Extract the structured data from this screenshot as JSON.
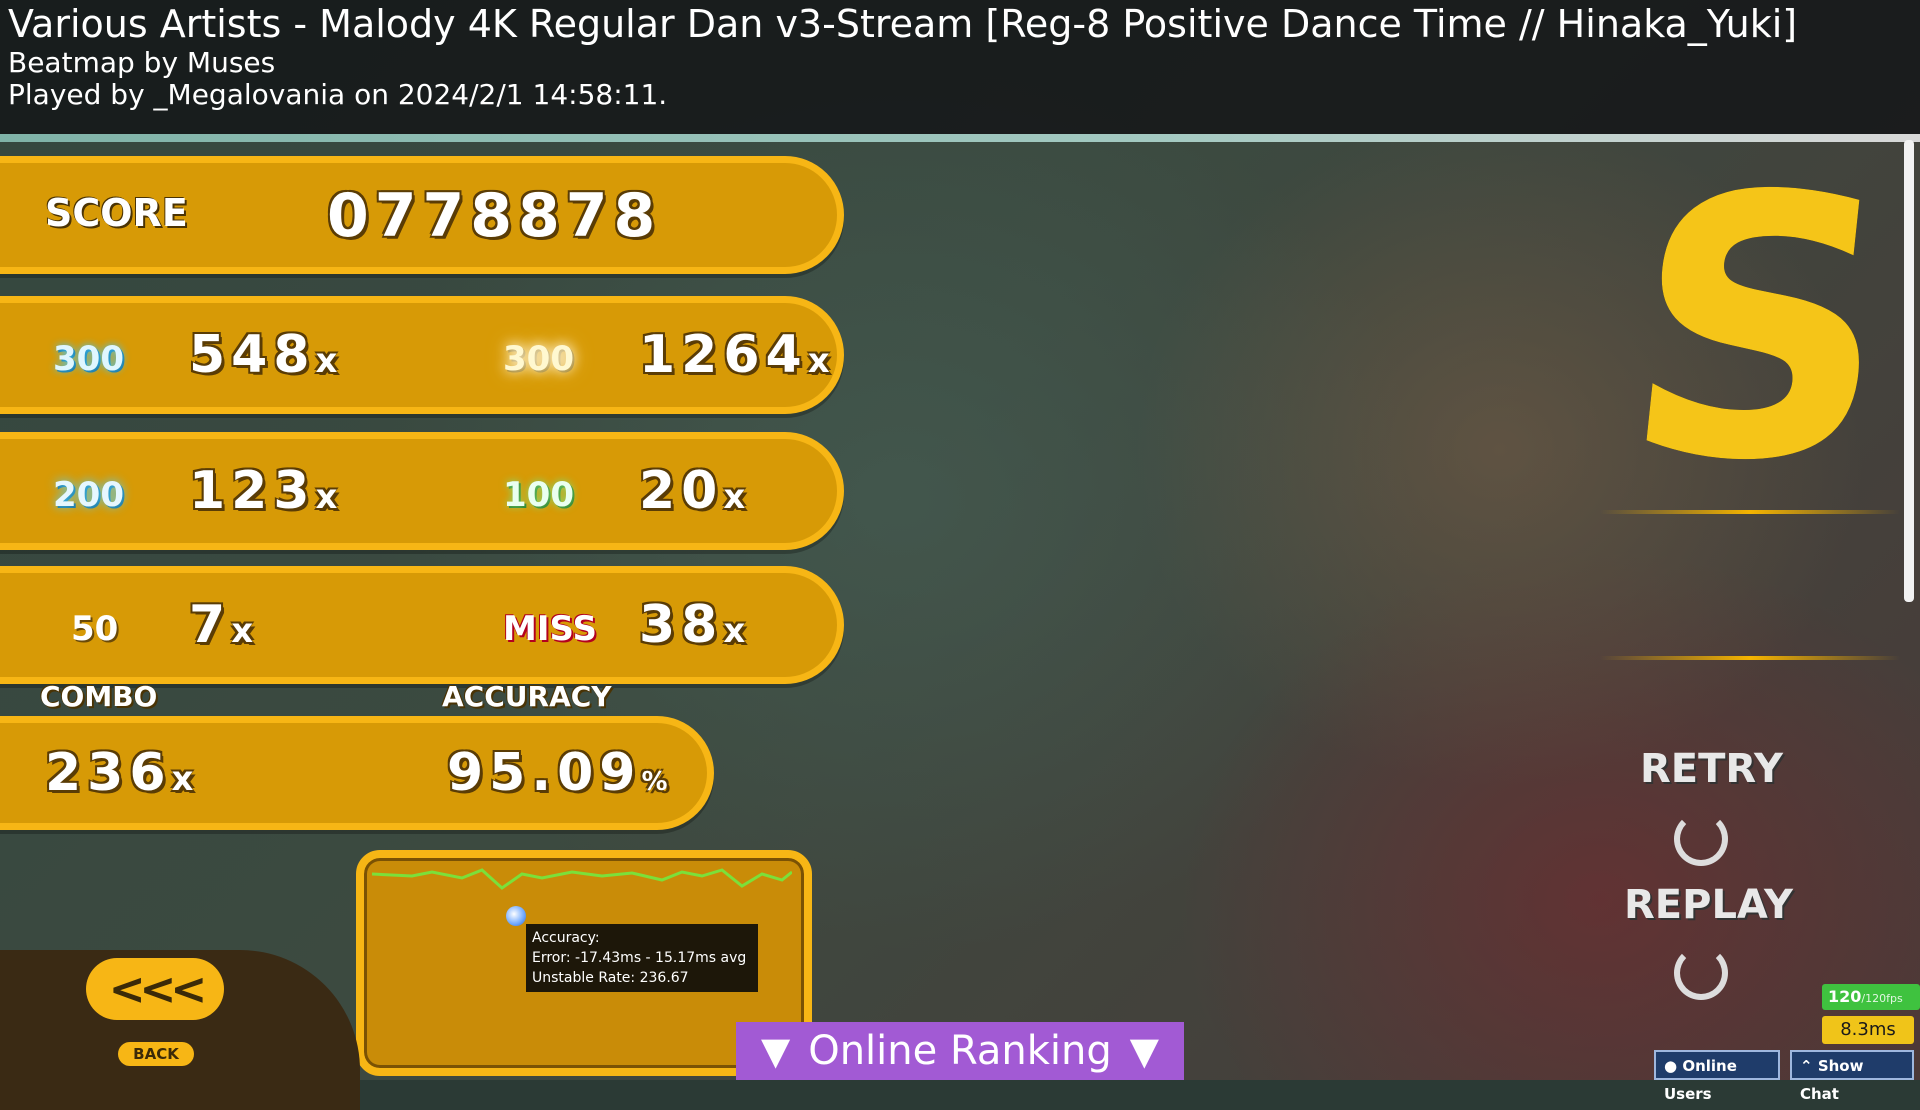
{
  "header": {
    "title": "Various Artists - Malody 4K Regular Dan v3-Stream [Reg-8 Positive Dance Time // Hinaka_Yuki]",
    "beatmap_by": "Beatmap by Muses",
    "played_by": "Played by _Megalovania on 2024/2/1 14:58:11."
  },
  "score": {
    "label": "SCORE",
    "value": "0778878"
  },
  "judgements": [
    {
      "icon": "300",
      "count": "548",
      "x": "x"
    },
    {
      "icon": "300",
      "count": "1264",
      "x": "x"
    },
    {
      "icon": "200",
      "count": "123",
      "x": "x"
    },
    {
      "icon": "100",
      "count": "20",
      "x": "x"
    },
    {
      "icon": "50",
      "count": "7",
      "x": "x"
    },
    {
      "icon": "MISS",
      "count": "38",
      "x": "x"
    }
  ],
  "combo": {
    "label": "COMBO",
    "value": "236",
    "unit": "x"
  },
  "accuracy": {
    "label": "ACCURACY",
    "value": "95.09",
    "unit": "%"
  },
  "rank": "S",
  "side": {
    "retry": "RETRY",
    "replay": "REPLAY"
  },
  "tooltip": {
    "line1": "Accuracy:",
    "line2": "Error: -17.43ms - 15.17ms avg",
    "line3": "Unstable Rate: 236.67"
  },
  "back": {
    "arrows": "<<<",
    "label": "BACK"
  },
  "online_ranking": {
    "label": "Online Ranking",
    "arrow": "▼"
  },
  "status": {
    "fps": "120",
    "fps_max": "/120fps",
    "frametime": "8.3ms"
  },
  "bottom_buttons": {
    "online_users": "Online Users",
    "show_chat": "Show Chat"
  },
  "colors": {
    "panel": "#d79a06",
    "panel_border": "#f7b615",
    "rank": "#f5c518",
    "ranking_bar": "#a25ad4"
  }
}
